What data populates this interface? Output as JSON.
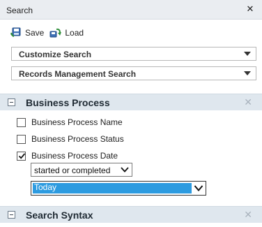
{
  "panel": {
    "title": "Search"
  },
  "toolbar": {
    "save_label": "Save",
    "load_label": "Load"
  },
  "dropdowns": {
    "customize_label": "Customize Search",
    "records_label": "Records Management Search"
  },
  "business_process": {
    "title": "Business Process",
    "fields": [
      {
        "label": "Business Process Name",
        "checked": false
      },
      {
        "label": "Business Process Status",
        "checked": false
      },
      {
        "label": "Business Process Date",
        "checked": true
      }
    ],
    "date_mode": "started or completed",
    "date_value": "Today"
  },
  "search_syntax": {
    "title": "Search Syntax"
  }
}
